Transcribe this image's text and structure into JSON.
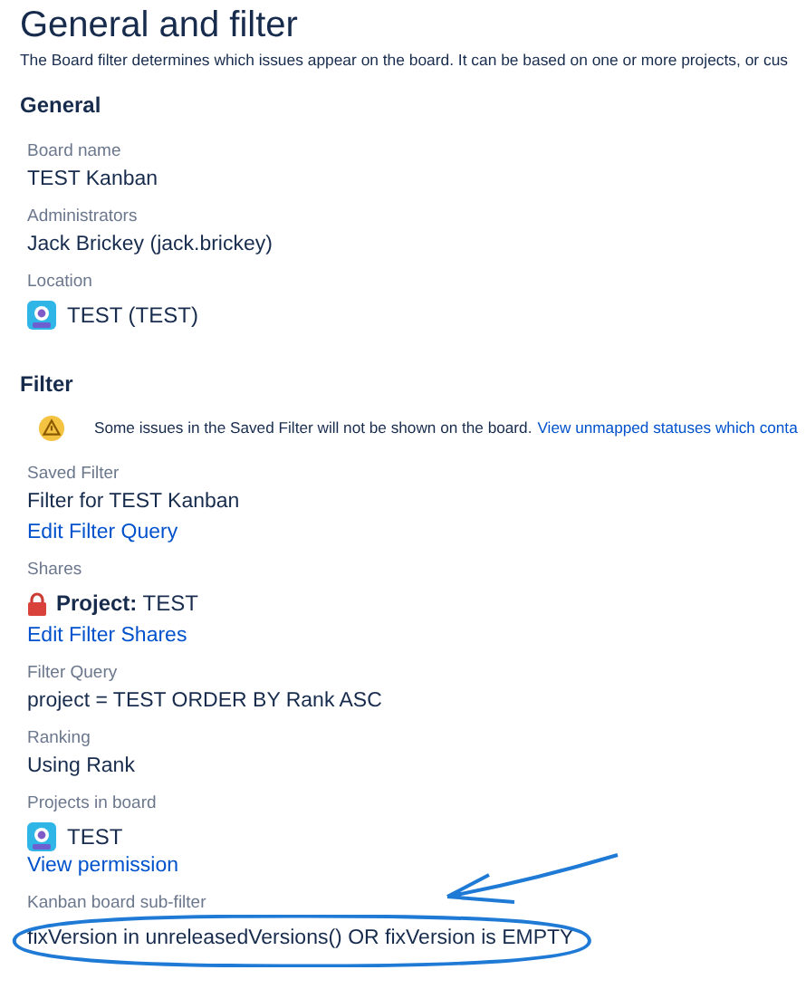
{
  "title": "General and filter",
  "description": "The Board filter determines which issues appear on the board. It can be based on one or more projects, or cus",
  "sections": [
    {
      "heading": "General",
      "fields": [
        {
          "label": "Board name",
          "kind": "text",
          "value": "TEST Kanban"
        },
        {
          "label": "Administrators",
          "kind": "text",
          "value": "Jack Brickey (jack.brickey)"
        },
        {
          "label": "Location",
          "kind": "project",
          "value": "TEST (TEST)"
        }
      ]
    },
    {
      "heading": "Filter",
      "warning": {
        "text": "Some issues in the Saved Filter will not be shown on the board.",
        "link": "View unmapped statuses which conta"
      },
      "fields": [
        {
          "label": "Saved Filter",
          "kind": "text",
          "value": "Filter for TEST Kanban",
          "link": "Edit Filter Query"
        },
        {
          "label": "Shares",
          "kind": "share",
          "value": "**Project:** TEST",
          "link": "Edit Filter Shares"
        },
        {
          "label": "Filter Query",
          "kind": "text",
          "value": "project = TEST ORDER BY Rank ASC"
        },
        {
          "label": "Ranking",
          "kind": "text",
          "value": "Using Rank"
        },
        {
          "label": "Projects in board",
          "kind": "project",
          "value": "TEST",
          "link": "View permission"
        },
        {
          "label": "Kanban board sub-filter",
          "kind": "text",
          "value": "fixVersion in unreleasedVersions() OR fixVersion is EMPTY",
          "annotated": true
        }
      ]
    }
  ]
}
